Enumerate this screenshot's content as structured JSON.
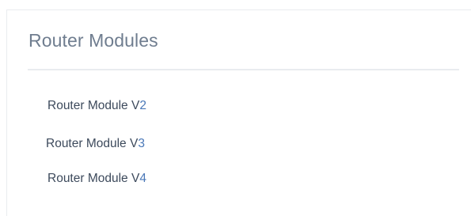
{
  "panel": {
    "title": "Router Modules"
  },
  "modules": [
    {
      "name": "Router Module V",
      "version": "2"
    },
    {
      "name": "Router Module V",
      "version": "3"
    },
    {
      "name": "Router Module V",
      "version": "4"
    }
  ],
  "colors": {
    "title": "#6f7d8f",
    "item_text": "#3d4a5c",
    "item_accent": "#4a78b8",
    "divider": "#e9ecef"
  }
}
